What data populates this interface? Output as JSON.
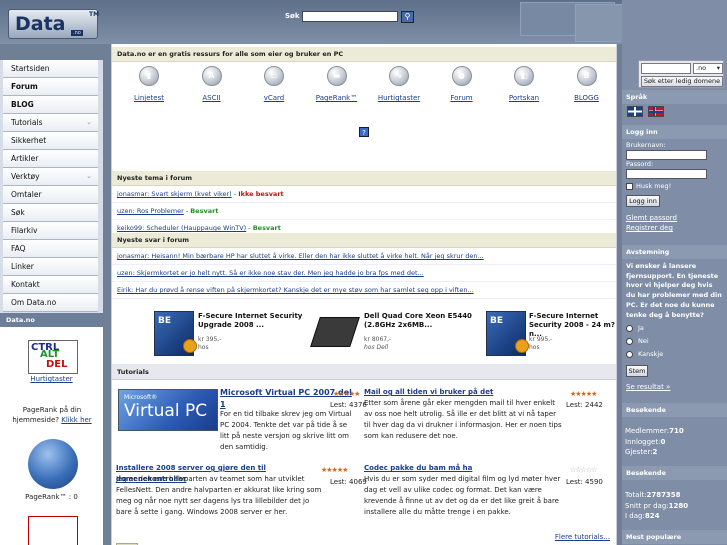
{
  "header": {
    "logo_main": "Data",
    "logo_tm": "TM",
    "logo_sub": ".no",
    "search_label": "Søk",
    "search_value": "",
    "search_button": "⚲"
  },
  "nav": {
    "items": [
      {
        "label": "Startsiden",
        "bold": false,
        "chevron": ""
      },
      {
        "label": "Forum",
        "bold": true,
        "chevron": ""
      },
      {
        "label": "BLOG",
        "bold": true,
        "chevron": ""
      },
      {
        "label": "Tutorials",
        "bold": false,
        "chevron": "⌄"
      },
      {
        "label": "Sikkerhet",
        "bold": false,
        "chevron": ""
      },
      {
        "label": "Artikler",
        "bold": false,
        "chevron": ""
      },
      {
        "label": "Verktøy",
        "bold": false,
        "chevron": "⌄"
      },
      {
        "label": "Omtaler",
        "bold": false,
        "chevron": ""
      },
      {
        "label": "Søk",
        "bold": false,
        "chevron": ""
      },
      {
        "label": "Filarkiv",
        "bold": false,
        "chevron": ""
      },
      {
        "label": "FAQ",
        "bold": false,
        "chevron": ""
      },
      {
        "label": "Linker",
        "bold": false,
        "chevron": ""
      },
      {
        "label": "Kontakt",
        "bold": false,
        "chevron": ""
      },
      {
        "label": "Om Data.no",
        "bold": false,
        "chevron": ""
      }
    ]
  },
  "left_block": {
    "title": "Data.no",
    "ctrl_line1": "CTRL",
    "ctrl_line2": "ALT",
    "ctrl_line3": "DEL",
    "ctrl_link": "Hurtigtaster",
    "pagerank_text": "PageRank på din hjemmeside?",
    "pagerank_link": "Klikk her",
    "pagerank_value": "PageRank™ : 0"
  },
  "main": {
    "intro": "Data.no er en gratis ressurs for alle som eier og bruker en PC",
    "tools": [
      {
        "label": "Linjetest",
        "icon": "bar-chart-icon",
        "glyph": "▮"
      },
      {
        "label": "ASCII",
        "icon": "ascii-icon",
        "glyph": "A"
      },
      {
        "label": "vCard",
        "icon": "vcard-icon",
        "glyph": "▭"
      },
      {
        "label": "PageRank™",
        "icon": "pagerank-icon",
        "glyph": "▬"
      },
      {
        "label": "Hurtigtaster",
        "icon": "keyboard-icon",
        "glyph": "∿"
      },
      {
        "label": "Forum",
        "icon": "chat-bubble-icon",
        "glyph": "●"
      },
      {
        "label": "Portskan",
        "icon": "port-icon",
        "glyph": "◧"
      },
      {
        "label": "BLOGG",
        "icon": "blog-icon",
        "glyph": "B"
      }
    ],
    "help": "?",
    "topics_head": "Nyeste tema i forum",
    "topics": [
      {
        "link": "jonasmar: Svart skjerm (kvet viker)",
        "sep": " - ",
        "status": "Ikke besvart",
        "ok": false
      },
      {
        "link": "uzen: Ros Problemer",
        "sep": " - ",
        "status": "Besvart",
        "ok": true
      },
      {
        "link": "keiko99: Scheduler (Hauppauge WinTV)",
        "sep": " - ",
        "status": "Besvart",
        "ok": true
      }
    ],
    "answers_head": "Nyeste svar i forum",
    "answers": [
      "jonasmar: Heisann! Min bærbare HP har sluttet å virke. Eller den har ikke sluttet å virke helt. Når jeg skrur den...",
      "uzen: Skjermkortet er jo helt nytt. Så er ikke noe stav der. Men jeg hadde jo bra fps med det...",
      "Eirik: Har du prøvd å rense viften på skjermkortet? Kanskje det er mye støv som har samlet seg opp i viften..."
    ],
    "ads": [
      {
        "title": "F-Secure Internet Security Upgrade 2008 ...",
        "price": "kr 395,-",
        "shop": "hos"
      },
      {
        "title": "Dell Quad Core Xeon E5440 (2.8GHz 2x6MB...",
        "price": "kr 8067,-",
        "shop": "hos Dell"
      },
      {
        "title": "F-Secure Internet Security 2008 - 24 m?n...",
        "price": "kr 995,-",
        "shop": "hos"
      }
    ],
    "tutorials_head": "Tutorials",
    "tutorials": [
      {
        "title": "Microsoft Virtual PC 2007 del 1",
        "reads": "Lest: 4376",
        "stars": "★★★★★",
        "body": "For en tid tilbake skrev jeg om Virtual PC 2004. Tenkte det var på tide å se litt på neste versjon og skrive litt om den samtidig."
      },
      {
        "title": "Mail og all tiden vi bruker på det",
        "reads": "Lest: 2442",
        "stars": "★★★★★",
        "body": "Etter som årene går eker mengden mail til hver enkelt av oss noe helt utrolig. Så ille er det blitt at vi nå taper til hver dag da vi drukner i informasjon. Her er noen tips som kan redusere det noe."
      },
      {
        "title": "Installere 2008 server og gjøre den til domenekontroller",
        "reads": "Lest: 4069",
        "stars": "★★★★★",
        "body": "Jeg er den ene halvparten av teamet som har utviklet FellesNett. Den andre halvparten er akkurat like kring som meg og når noe nytt ser dagens lys tra lillebilder det jo bare å sette i gang. Windows 2008 server er her."
      },
      {
        "title": "Codec pakke du bam må ha",
        "reads": "Lest: 4590",
        "stars": "☆☆☆☆☆",
        "body": "Hvis du er som syder med digital film og lyd møter hver dag et vell av ulike codec og format. Det kan være krevende å finne ut av det og da er det like greit å bare installere alle du måtte trenge i en pakke."
      }
    ],
    "vpc_ms": "Microsoft®",
    "vpc_name": "Virtual PC",
    "more_tutorials": "Flere tutorials..."
  },
  "right": {
    "domain_value": "",
    "domain_tld": ".no",
    "domain_button": "Søk etter ledig domene",
    "lang_title": "Språk",
    "login_title": "Logg inn",
    "user_label": "Brukernavn:",
    "pass_label": "Passord:",
    "remember_label": "Husk meg!",
    "login_button": "Logg inn",
    "forgot_link": "Glemt passord",
    "register_link": "Registrer deg",
    "poll_title": "Avstemning",
    "poll_question": "Vi ønsker å lansere fjernsupport. En tjeneste hvor vi hjelper deg hvis du har problemer med din PC. Er det noe du kunne tenke deg å benytte?",
    "poll_options": [
      "Ja",
      "Nei",
      "Kanskje"
    ],
    "vote_button": "Stem",
    "results_link": "Se resultat »",
    "visitors_title": "Besøkende",
    "members_label": "Medlemmer:",
    "members_value": "710",
    "online_label": "Innlogget:",
    "online_value": "0",
    "guests_label": "Gjester:",
    "guests_value": "2",
    "visits_title": "Besøkende",
    "total_label": "Totalt:",
    "total_value": "2787358",
    "avg_label": "Snitt pr dag:",
    "avg_value": "1280",
    "today_label": "I dag:",
    "today_value": "824",
    "popular_title": "Mest populære"
  }
}
